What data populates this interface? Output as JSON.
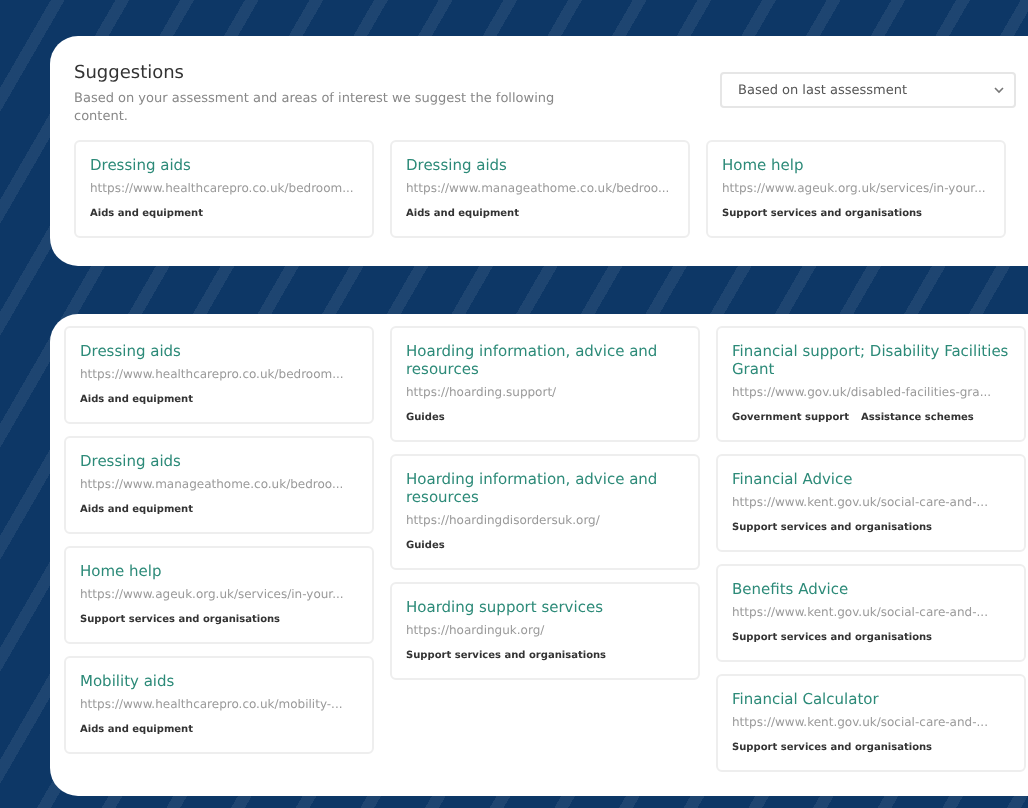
{
  "suggestions": {
    "title": "Suggestions",
    "description": "Based on your assessment and areas of interest we suggest the following content.",
    "filter": {
      "value": "Based on last assessment"
    },
    "cards": [
      {
        "title": "Dressing aids",
        "url": "https://www.healthcarepro.co.uk/bedroom...",
        "tags": [
          "Aids and equipment"
        ]
      },
      {
        "title": "Dressing aids",
        "url": "https://www.manageathome.co.uk/bedroo...",
        "tags": [
          "Aids and equipment"
        ]
      },
      {
        "title": "Home help",
        "url": "https://www.ageuk.org.uk/services/in-your...",
        "tags": [
          "Support services and organisations"
        ]
      }
    ]
  },
  "results": {
    "columns": [
      [
        {
          "title": "Dressing aids",
          "url": "https://www.healthcarepro.co.uk/bedroom...",
          "tags": [
            "Aids and equipment"
          ]
        },
        {
          "title": "Dressing aids",
          "url": "https://www.manageathome.co.uk/bedroo...",
          "tags": [
            "Aids and equipment"
          ]
        },
        {
          "title": "Home help",
          "url": "https://www.ageuk.org.uk/services/in-your...",
          "tags": [
            "Support services and organisations"
          ]
        },
        {
          "title": "Mobility aids",
          "url": "https://www.healthcarepro.co.uk/mobility-...",
          "tags": [
            "Aids and equipment"
          ]
        }
      ],
      [
        {
          "title": "Hoarding information, advice and resources",
          "url": "https://hoarding.support/",
          "tags": [
            "Guides"
          ]
        },
        {
          "title": "Hoarding information, advice and resources",
          "url": "https://hoardingdisordersuk.org/",
          "tags": [
            "Guides"
          ]
        },
        {
          "title": "Hoarding support services",
          "url": "https://hoardinguk.org/",
          "tags": [
            "Support services and organisations"
          ]
        }
      ],
      [
        {
          "title": "Financial support; Disability Facilities Grant",
          "url": "https://www.gov.uk/disabled-facilities-gra...",
          "tags": [
            "Government support",
            "Assistance schemes"
          ]
        },
        {
          "title": "Financial Advice",
          "url": "https://www.kent.gov.uk/social-care-and-...",
          "tags": [
            "Support services and organisations"
          ]
        },
        {
          "title": "Benefits Advice",
          "url": "https://www.kent.gov.uk/social-care-and-...",
          "tags": [
            "Support services and organisations"
          ]
        },
        {
          "title": "Financial Calculator",
          "url": "https://www.kent.gov.uk/social-care-and-...",
          "tags": [
            "Support services and organisations"
          ]
        }
      ]
    ]
  }
}
